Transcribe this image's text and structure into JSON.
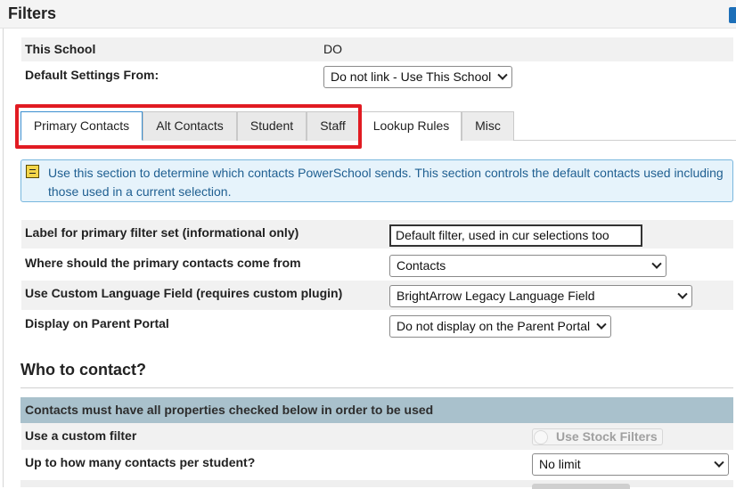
{
  "header": {
    "title": "Filters"
  },
  "school": {
    "this_school_label": "This School",
    "this_school_value": "DO",
    "default_settings_label": "Default Settings From:",
    "default_settings_value": "Do not link - Use This School"
  },
  "tabs": [
    {
      "label": "Primary Contacts",
      "active": true
    },
    {
      "label": "Alt Contacts",
      "active": false
    },
    {
      "label": "Student",
      "active": false
    },
    {
      "label": "Staff",
      "active": false
    },
    {
      "label": "Lookup Rules",
      "active": false
    },
    {
      "label": "Misc",
      "active": false
    }
  ],
  "info": {
    "text": "Use this section to determine which contacts PowerSchool sends. This section controls the default contacts used including those used in a current selection."
  },
  "settings": {
    "label_filter_label": "Label for primary filter set (informational only)",
    "label_filter_value": "Default filter, used in cur selections too",
    "contacts_source_label": "Where should the primary contacts come from",
    "contacts_source_value": "Contacts",
    "language_field_label": "Use Custom Language Field (requires custom plugin)",
    "language_field_value": "BrightArrow Legacy Language Field",
    "parent_portal_label": "Display on Parent Portal",
    "parent_portal_value": "Do not display on the Parent Portal"
  },
  "who": {
    "title": "Who to contact?",
    "table_header": "Contacts must have all properties checked below in order to be used",
    "custom_filter_label": "Use a custom filter",
    "stock_filters_label": "Use Stock Filters",
    "stock_filters_enabled": false,
    "contacts_per_student_label": "Up to how many contacts per student?",
    "contacts_per_student_value": "No limit"
  },
  "colors": {
    "highlight": "#e11b22",
    "info_text": "#1f5f91",
    "info_bg": "#e6f3fb",
    "table_header_bg": "#a9c1cc"
  }
}
